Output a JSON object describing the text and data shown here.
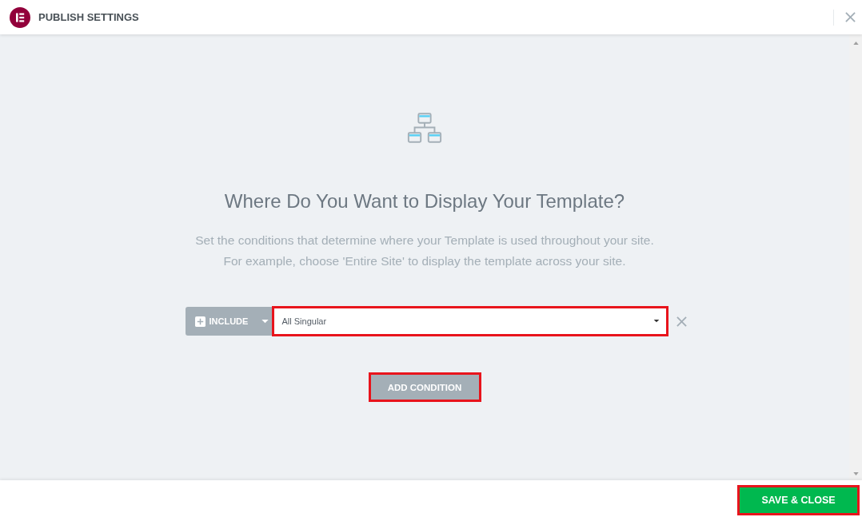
{
  "header": {
    "title": "PUBLISH SETTINGS"
  },
  "intro": {
    "heading": "Where Do You Want to Display Your Template?",
    "description": [
      "Set the conditions that determine where your Template is used throughout your site.",
      "For example, choose 'Entire Site' to display the template across your site."
    ]
  },
  "conditions": [
    {
      "type": "INCLUDE",
      "value": "All Singular",
      "highlighted": true
    }
  ],
  "add_button": {
    "label": "ADD CONDITION",
    "highlighted": true
  },
  "footer": {
    "save_button": {
      "label": "SAVE & CLOSE",
      "highlighted": true
    }
  }
}
